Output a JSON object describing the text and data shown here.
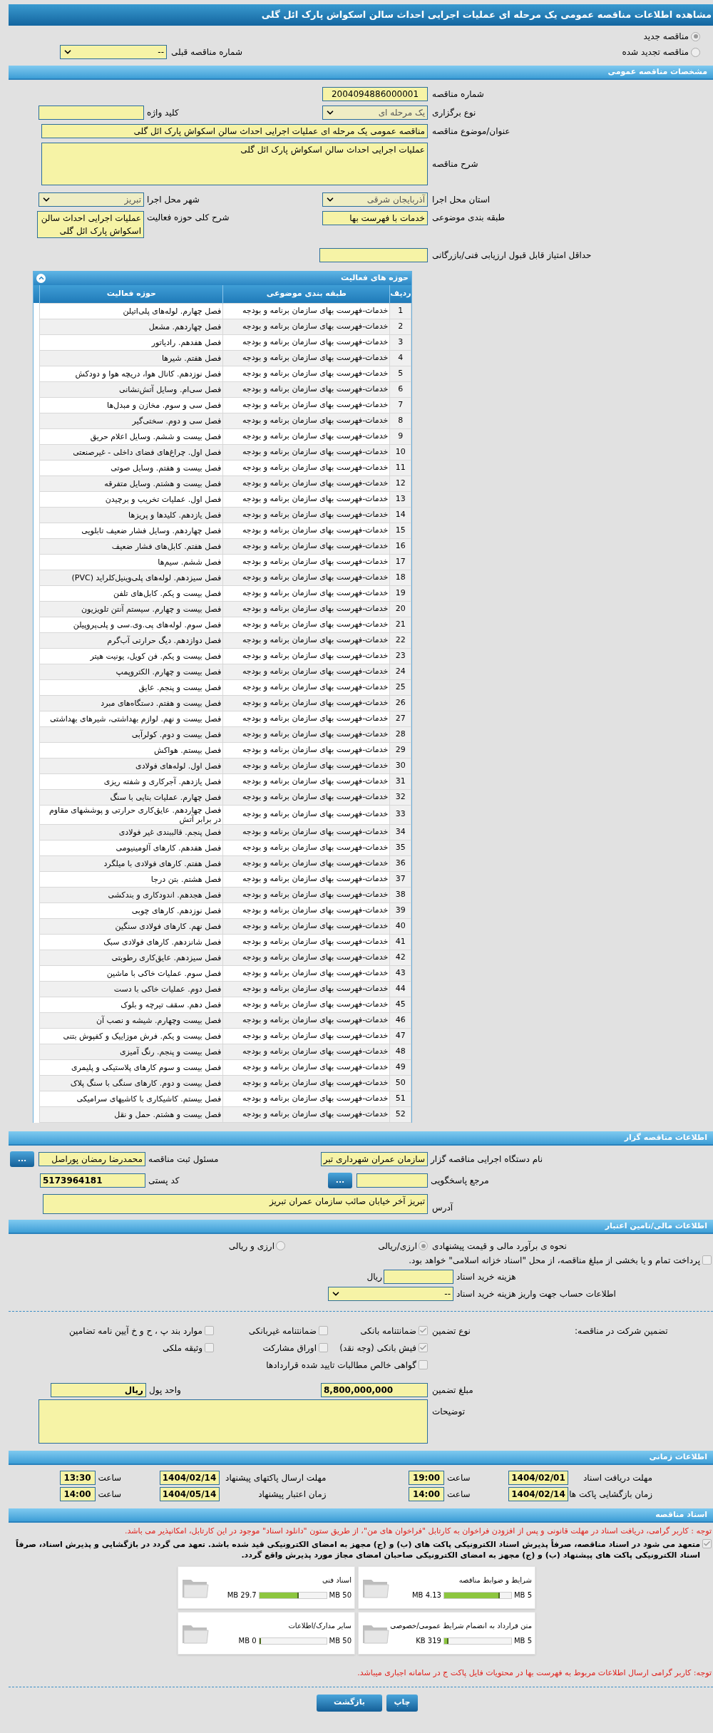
{
  "page_title": "مشاهده اطلاعات مناقصه عمومی یک مرحله ای عملیات اجرایی احداث سالن اسکواش پارک ائل گلی",
  "tender_mode": [
    {
      "label": "مناقصه جدید",
      "selected": true
    },
    {
      "label": "مناقصه تجدید شده",
      "selected": false
    }
  ],
  "previous_tender": {
    "label": "شماره مناقصه قبلی",
    "value": "--"
  },
  "general": {
    "title": "مشخصات مناقصه عمومی",
    "tender_number": {
      "label": "شماره مناقصه",
      "value": "2004094886000001"
    },
    "holding_type": {
      "label": "نوع برگزاری",
      "value": "یک مرحله ای"
    },
    "keyword": {
      "label": "کلید واژه"
    },
    "subject": {
      "label": "عنوان/موضوع مناقصه",
      "value": "مناقصه عمومی یک مرحله ای عملیات اجرایی احداث سالن اسکواش پارک ائل گلی"
    },
    "description": {
      "label": "شرح مناقصه",
      "value": "عملیات اجرایی احداث سالن اسکواش پارک ائل گلی"
    },
    "province": {
      "label": "استان محل اجرا",
      "value": "آذربایجان شرقی"
    },
    "city": {
      "label": "شهر محل اجرا",
      "value": "تبریز"
    },
    "category": {
      "label": "طبقه بندی موضوعی",
      "value": "خدمات با فهرست بها"
    },
    "activity_summary": {
      "label": "شرح کلی حوزه فعالیت",
      "value": "عملیات اجرایی احداث سالن اسکواش پارک ائل گلی"
    },
    "min_score": {
      "label": "حداقل امتیاز قابل قبول ارزیابی فنی/بازرگانی"
    }
  },
  "activities": {
    "title": "حوزه های فعالیت",
    "expanded": true,
    "columns": [
      "ردیف",
      "طبقه بندی موضوعی",
      "حوزه فعالیت"
    ],
    "rows": [
      {
        "n": "1",
        "category": "خدمات-فهرست بهای سازمان برنامه و بودجه",
        "activity": "فصل چهارم. لوله‌های پلی‌اتیلن"
      },
      {
        "n": "2",
        "category": "خدمات-فهرست بهای سازمان برنامه و بودجه",
        "activity": "فصل چهاردهم. مشعل"
      },
      {
        "n": "3",
        "category": "خدمات-فهرست بهای سازمان برنامه و بودجه",
        "activity": "فصل هفدهم. رادیاتور"
      },
      {
        "n": "4",
        "category": "خدمات-فهرست بهای سازمان برنامه و بودجه",
        "activity": "فصل هفتم. شیرها"
      },
      {
        "n": "5",
        "category": "خدمات-فهرست بهای سازمان برنامه و بودجه",
        "activity": "فصل نوزدهم. کانال هوا، دریچه هوا و دودکش"
      },
      {
        "n": "6",
        "category": "خدمات-فهرست بهای سازمان برنامه و بودجه",
        "activity": "فصل سی‌ام. وسایل آتش‌نشانی"
      },
      {
        "n": "7",
        "category": "خدمات-فهرست بهای سازمان برنامه و بودجه",
        "activity": "فصل سی و سوم. مخازن و مبدل‌ها"
      },
      {
        "n": "8",
        "category": "خدمات-فهرست بهای سازمان برنامه و بودجه",
        "activity": "فصل سی و دوم. سختی‌گیر"
      },
      {
        "n": "9",
        "category": "خدمات-فهرست بهای سازمان برنامه و بودجه",
        "activity": "فصل بیست و ششم. وسایل اعلام حریق"
      },
      {
        "n": "10",
        "category": "خدمات-فهرست بهای سازمان برنامه و بودجه",
        "activity": "فصل اول. چراغ‌های فضای داخلی - غیرصنعتی"
      },
      {
        "n": "11",
        "category": "خدمات-فهرست بهای سازمان برنامه و بودجه",
        "activity": "فصل بیست و هفتم. وسایل صوتی"
      },
      {
        "n": "12",
        "category": "خدمات-فهرست بهای سازمان برنامه و بودجه",
        "activity": "فصل بیست و هشتم. وسایل متفرقه"
      },
      {
        "n": "13",
        "category": "خدمات-فهرست بهای سازمان برنامه و بودجه",
        "activity": "فصل اول. عملیات تخریب و برچیدن"
      },
      {
        "n": "14",
        "category": "خدمات-فهرست بهای سازمان برنامه و بودجه",
        "activity": "فصل یازدهم. کلیدها و پریزها"
      },
      {
        "n": "15",
        "category": "خدمات-فهرست بهای سازمان برنامه و بودجه",
        "activity": "فصل چهاردهم. وسایل فشار ضعیف تابلویی"
      },
      {
        "n": "16",
        "category": "خدمات-فهرست بهای سازمان برنامه و بودجه",
        "activity": "فصل هفتم. کابل‌های فشار ضعیف"
      },
      {
        "n": "17",
        "category": "خدمات-فهرست بهای سازمان برنامه و بودجه",
        "activity": "فصل ششم. سیم‌ها"
      },
      {
        "n": "18",
        "category": "خدمات-فهرست بهای سازمان برنامه و بودجه",
        "activity": "فصل سیزدهم. لوله‌های پلی‌وینیل‌کلراید (PVC)"
      },
      {
        "n": "19",
        "category": "خدمات-فهرست بهای سازمان برنامه و بودجه",
        "activity": "فصل بیست و یکم. کابل‌های تلفن"
      },
      {
        "n": "20",
        "category": "خدمات-فهرست بهای سازمان برنامه و بودجه",
        "activity": "فصل بیست و چهارم. سیستم آنتن تلویزیون"
      },
      {
        "n": "21",
        "category": "خدمات-فهرست بهای سازمان برنامه و بودجه",
        "activity": "فصل سوم. لوله‌های پی.وی.سی و پلی‌پروپیلن"
      },
      {
        "n": "22",
        "category": "خدمات-فهرست بهای سازمان برنامه و بودجه",
        "activity": "فصل دوازدهم. دیگ حرارتی آب‌گرم"
      },
      {
        "n": "23",
        "category": "خدمات-فهرست بهای سازمان برنامه و بودجه",
        "activity": "فصل بیست و یکم. فن کویل، یونیت هیتر"
      },
      {
        "n": "24",
        "category": "خدمات-فهرست بهای سازمان برنامه و بودجه",
        "activity": "فصل بیست و چهارم. الکتروپمپ"
      },
      {
        "n": "25",
        "category": "خدمات-فهرست بهای سازمان برنامه و بودجه",
        "activity": "فصل بیست و پنجم. عایق"
      },
      {
        "n": "26",
        "category": "خدمات-فهرست بهای سازمان برنامه و بودجه",
        "activity": "فصل بیست و هفتم. دستگاه‌های مبرد"
      },
      {
        "n": "27",
        "category": "خدمات-فهرست بهای سازمان برنامه و بودجه",
        "activity": "فصل بیست و نهم. لوازم بهداشتی، شیرهای بهداشتی"
      },
      {
        "n": "28",
        "category": "خدمات-فهرست بهای سازمان برنامه و بودجه",
        "activity": "فصل بیست و دوم. کولرآبی"
      },
      {
        "n": "29",
        "category": "خدمات-فهرست بهای سازمان برنامه و بودجه",
        "activity": "فصل بیستم. هواکش"
      },
      {
        "n": "30",
        "category": "خدمات-فهرست بهای سازمان برنامه و بودجه",
        "activity": "فصل اول. لوله‌های فولادی"
      },
      {
        "n": "31",
        "category": "خدمات-فهرست بهای سازمان برنامه و بودجه",
        "activity": "فصل یازدهم. آجرکاری و شفته ریزی"
      },
      {
        "n": "32",
        "category": "خدمات-فهرست بهای سازمان برنامه و بودجه",
        "activity": "فصل چهارم. عملیات بنایی با سنگ"
      },
      {
        "n": "33",
        "category": "خدمات-فهرست بهای سازمان برنامه و بودجه",
        "activity": "فصل چهاردهم. عایق‌کاری حرارتی و پوششهای مقاوم در برابر آتش"
      },
      {
        "n": "34",
        "category": "خدمات-فهرست بهای سازمان برنامه و بودجه",
        "activity": "فصل پنجم. قالببندی غیر فولادی"
      },
      {
        "n": "35",
        "category": "خدمات-فهرست بهای سازمان برنامه و بودجه",
        "activity": "فصل هفدهم. کارهای آلومینیومی"
      },
      {
        "n": "36",
        "category": "خدمات-فهرست بهای سازمان برنامه و بودجه",
        "activity": "فصل هفتم. کارهای فولادی با میلگرد"
      },
      {
        "n": "37",
        "category": "خدمات-فهرست بهای سازمان برنامه و بودجه",
        "activity": "فصل هشتم. بتن درجا"
      },
      {
        "n": "38",
        "category": "خدمات-فهرست بهای سازمان برنامه و بودجه",
        "activity": "فصل هجدهم. اندودکاری و بندکشی"
      },
      {
        "n": "39",
        "category": "خدمات-فهرست بهای سازمان برنامه و بودجه",
        "activity": "فصل نوزدهم. کارهای چوبی"
      },
      {
        "n": "40",
        "category": "خدمات-فهرست بهای سازمان برنامه و بودجه",
        "activity": "فصل نهم. کارهای فولادی سنگین"
      },
      {
        "n": "41",
        "category": "خدمات-فهرست بهای سازمان برنامه و بودجه",
        "activity": "فصل شانزدهم. کارهای فولادی سبک"
      },
      {
        "n": "42",
        "category": "خدمات-فهرست بهای سازمان برنامه و بودجه",
        "activity": "فصل سیزدهم. عایق‌کاری رطوبتی"
      },
      {
        "n": "43",
        "category": "خدمات-فهرست بهای سازمان برنامه و بودجه",
        "activity": "فصل سوم. عملیات خاکی با ماشین"
      },
      {
        "n": "44",
        "category": "خدمات-فهرست بهای سازمان برنامه و بودجه",
        "activity": "فصل دوم. عملیات خاکی با دست"
      },
      {
        "n": "45",
        "category": "خدمات-فهرست بهای سازمان برنامه و بودجه",
        "activity": "فصل دهم. سقف تیرچه و بلوک"
      },
      {
        "n": "46",
        "category": "خدمات-فهرست بهای سازمان برنامه و بودجه",
        "activity": "فصل بیست وچهارم. شیشه و نصب آن"
      },
      {
        "n": "47",
        "category": "خدمات-فهرست بهای سازمان برنامه و بودجه",
        "activity": "فصل بیست و یکم. فرش موزاییک و کفپوش بتنی"
      },
      {
        "n": "48",
        "category": "خدمات-فهرست بهای سازمان برنامه و بودجه",
        "activity": "فصل بیست و پنجم. رنگ آمیزی"
      },
      {
        "n": "49",
        "category": "خدمات-فهرست بهای سازمان برنامه و بودجه",
        "activity": "فصل بیست و سوم کارهای پلاستیکی و پلیمری"
      },
      {
        "n": "50",
        "category": "خدمات-فهرست بهای سازمان برنامه و بودجه",
        "activity": "فصل بیست و دوم. کارهای سنگی با سنگ پلاک"
      },
      {
        "n": "51",
        "category": "خدمات-فهرست بهای سازمان برنامه و بودجه",
        "activity": "فصل بیستم. کاشیکاری با کاشیهای سرامیکی"
      },
      {
        "n": "52",
        "category": "خدمات-فهرست بهای سازمان برنامه و بودجه",
        "activity": "فصل بیست و هشتم. حمل و نقل"
      }
    ]
  },
  "organizer": {
    "title": "اطلاعات مناقصه گزار",
    "org_name": {
      "label": "نام دستگاه اجرایی مناقصه گزار",
      "value": "سازمان عمران شهرداری تبر"
    },
    "registrar": {
      "label": "مسئول ثبت مناقصه",
      "value": "محمدرضا رمضان پوراصل",
      "button": "..."
    },
    "reference": {
      "label": "مرجع پاسخگویی",
      "button": "..."
    },
    "postal_code": {
      "label": "کد پستی",
      "value": "5173964181"
    },
    "address": {
      "label": "آدرس",
      "value": "تبریز آخر خیابان صائب سازمان عمران تبریز"
    }
  },
  "finance": {
    "title": "اطلاعات مالی/تامین اعتبار",
    "estimate": {
      "label": "نحوه ی برآورد مالی و قیمت پیشنهادی",
      "options": [
        {
          "label": "ارزی/ریالی",
          "selected": true
        },
        {
          "label": "ارزی و ریالی",
          "selected": false
        }
      ]
    },
    "treasury": {
      "label": "پرداخت تمام و یا بخشی از مبلغ مناقصه، از محل \"اسناد خزانه اسلامی\" خواهد بود.",
      "checked": false
    },
    "doc_fee": {
      "label": "هزینه خرید اسناد",
      "unit": "ریال"
    },
    "account": {
      "label": "اطلاعات حساب جهت واریز هزینه خرید اسناد",
      "value": "--"
    }
  },
  "guarantee": {
    "label": "تضمین شرکت در مناقصه:",
    "type_label": "نوع تضمین",
    "options": [
      {
        "label": "ضمانتنامه بانکی",
        "checked": true
      },
      {
        "label": "ضمانتنامه غیربانکی",
        "checked": false
      },
      {
        "label": "موارد بند پ ، ح و خ آیین نامه تضامین",
        "checked": false
      },
      {
        "label": "فیش بانکی (وجه نقد)",
        "checked": true
      },
      {
        "label": "اوراق مشارکت",
        "checked": false
      },
      {
        "label": "وثیقه ملکی",
        "checked": false
      },
      {
        "label": "گواهی خالص مطالبات تایید شده قراردادها",
        "checked": false
      }
    ],
    "amount": {
      "label": "مبلغ تضمین",
      "value": "8,800,000,000"
    },
    "currency": {
      "label": "واحد پول",
      "value": "ریال"
    },
    "notes": {
      "label": "توضیحات"
    }
  },
  "timing": {
    "title": "اطلاعات زمانی",
    "items": [
      {
        "label": "مهلت دریافت اسناد",
        "date": "1404/02/01",
        "time_label": "ساعت",
        "time": "19:00"
      },
      {
        "label": "مهلت ارسال پاکتهای پیشنهاد",
        "date": "1404/02/14",
        "time_label": "ساعت",
        "time": "13:30"
      },
      {
        "label": "زمان بازگشایی پاکت ها",
        "date": "1404/02/14",
        "time_label": "ساعت",
        "time": "14:00"
      },
      {
        "label": "زمان اعتبار پیشنهاد",
        "date": "1404/05/14",
        "time_label": "ساعت",
        "time": "14:00"
      }
    ]
  },
  "documents": {
    "title": "اسناد مناقصه",
    "note": "توجه : کاربر گرامی، دریافت اسناد در مهلت قانونی و پس از افزودن فراخوان به کارتابل \"فراخوان های من\"، از طریق ستون \"دانلود اسناد\" موجود در این کارتابل، امکانپذیر می باشد.",
    "commitment": {
      "checked": true,
      "text": "متعهد می شود در اسناد مناقصه، صرفاً پذیرش اسناد الکترونیکی پاکت های (ب) و (ج) مجهز به امضای الکترونیکی قید شده باشد. تعهد می گردد در بازگشایی و پذیرش اسناد، صرفاً اسناد الکترونیکی پاکت های پیشنهاد (ب) و (ج) مجهز به امضای الکترونیکی صاحبان امضای مجاز مورد پذیرش واقع گردد."
    },
    "files": [
      {
        "name": "شرایط و ضوابط مناقصه",
        "size": "4.13 MB",
        "max": "5 MB",
        "level": 0.83
      },
      {
        "name": "اسناد فنی",
        "size": "29.7 MB",
        "max": "50 MB",
        "level": 0.59
      },
      {
        "name": "متن قرارداد به انضمام شرایط عمومی/خصوصی",
        "size": "319 KB",
        "max": "5 MB",
        "level": 0.06
      },
      {
        "name": "سایر مدارک/اطلاعات",
        "size": "0 MB",
        "max": "50 MB",
        "level": 0
      }
    ],
    "footer_note": "توجه: کاربر گرامی ارسال اطلاعات مربوط به فهرست بها در محتویات فایل پاکت ج در سامانه اجباری میباشد."
  },
  "buttons": [
    {
      "label": "چاپ",
      "kind": "print"
    },
    {
      "label": "بازگشت",
      "kind": "back"
    }
  ]
}
